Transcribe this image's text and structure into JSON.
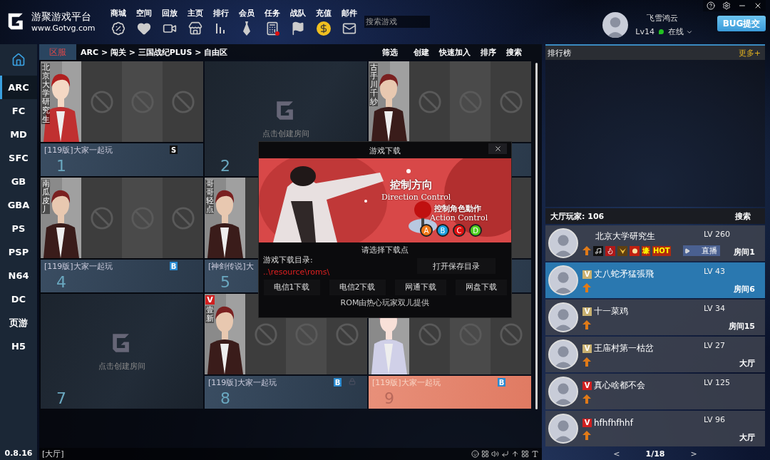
{
  "app": {
    "title": "游聚游戏平台",
    "url": "www.Gotvg.com"
  },
  "nav": [
    {
      "label": "商城",
      "kind": "sale"
    },
    {
      "label": "空间",
      "kind": "heart"
    },
    {
      "label": "回放",
      "kind": "video"
    },
    {
      "label": "主页",
      "kind": "store"
    },
    {
      "label": "排行",
      "kind": "bars"
    },
    {
      "label": "会员",
      "kind": "tie"
    },
    {
      "label": "任务",
      "kind": "calc",
      "alert": true
    },
    {
      "label": "战队",
      "kind": "flag"
    },
    {
      "label": "充值",
      "kind": "coin"
    },
    {
      "label": "邮件",
      "kind": "mail"
    }
  ],
  "search": {
    "placeholder": "搜索游戏"
  },
  "user": {
    "name": "飞雪鸿云",
    "level": "Lv14",
    "status": "在线"
  },
  "bug_button": "BUG提交",
  "sidebar": {
    "items": [
      {
        "label": "ARC",
        "selected": true
      },
      {
        "label": "FC",
        "selected": false
      },
      {
        "label": "MD",
        "selected": false
      },
      {
        "label": "SFC",
        "selected": false
      },
      {
        "label": "GB",
        "selected": false
      },
      {
        "label": "GBA",
        "selected": false
      },
      {
        "label": "PS",
        "selected": false
      },
      {
        "label": "PSP",
        "selected": false
      },
      {
        "label": "N64",
        "selected": false
      },
      {
        "label": "DC",
        "selected": false
      },
      {
        "label": "页游",
        "selected": false
      },
      {
        "label": "H5",
        "selected": false
      }
    ],
    "version": "0.8.16"
  },
  "breadcrumb": {
    "tab": "区服",
    "path": "ARC > 闯关 > 三国战纪PLUS > 自由区",
    "actions": [
      "筛选",
      "创建",
      "快速加入",
      "排序",
      "搜索"
    ]
  },
  "rooms": [
    {
      "kind": "occupied",
      "portrait": true,
      "player": "北京大学研究生",
      "title": "[119版]大家一起玩",
      "badge": "S",
      "number": "1",
      "locked": false,
      "selected": false
    },
    {
      "kind": "empty",
      "prompt": "点击创建房间",
      "number": "2"
    },
    {
      "kind": "occupied",
      "portrait": true,
      "player": "古手川千紗",
      "locked": false,
      "selected": false
    },
    {
      "kind": "occupied",
      "portrait": true,
      "player": "南瓜皮丿",
      "title": "[119版]大家一起玩",
      "badge": "B",
      "number": "4",
      "locked": false,
      "selected": false
    },
    {
      "kind": "occupied_covered",
      "portrait": true,
      "player": "哥哥轻点",
      "title": "[神剑传说]大",
      "number": "5",
      "locked": false,
      "selected": false
    },
    {
      "kind": "covered"
    },
    {
      "kind": "empty",
      "prompt": "点击创建房间",
      "number": "7"
    },
    {
      "kind": "occupied",
      "portrait": true,
      "vip": "V",
      "player": "壹新",
      "title": "[119版]大家一起玩",
      "badge": "B",
      "locked": true,
      "number": "8",
      "selected": false
    },
    {
      "kind": "occupied",
      "portrait": true,
      "title": "[119版]大家一起玩",
      "badge": "B",
      "number": "9",
      "locked": false,
      "selected": true
    }
  ],
  "status_bar": {
    "location": "[大厅]"
  },
  "ranking": {
    "title": "排行榜",
    "more": "更多+"
  },
  "lobby": {
    "title": "大厅玩家: 106",
    "search": "搜索",
    "page": "1/18",
    "prev": "<",
    "next": ">",
    "players": [
      {
        "name": "北京大学研究生",
        "level": "LV 260",
        "location": "房间1",
        "selected": false,
        "badges": [
          {
            "kind": "note"
          },
          {
            "kind": "fist"
          },
          {
            "kind": "wings"
          },
          {
            "kind": "bomb"
          },
          {
            "kind": "text",
            "text": "壕"
          },
          {
            "kind": "text",
            "text": "HOT"
          }
        ],
        "live": "直播"
      },
      {
        "name": "丈八蛇矛猛張飛",
        "level": "LV 43",
        "location": "房间6",
        "selected": true,
        "vip": {
          "text": "V",
          "kind": "gold"
        }
      },
      {
        "name": "十一菜鸡",
        "level": "LV 34",
        "location": "房间15",
        "selected": false,
        "vip": {
          "text": "V",
          "kind": "gold"
        }
      },
      {
        "name": "王庙村第一枯岔",
        "level": "LV 27",
        "location": "大厅",
        "selected": false,
        "vip": {
          "text": "V",
          "kind": "gold"
        }
      },
      {
        "name": "真心啥都不会",
        "level": "LV 125",
        "selected": false,
        "vip": {
          "text": "V",
          "kind": "red"
        }
      },
      {
        "name": "hfhfhfhhf",
        "level": "LV 96",
        "location": "大厅",
        "selected": false,
        "vip": {
          "text": "V",
          "kind": "red"
        }
      }
    ]
  },
  "dialog": {
    "title": "游戏下载",
    "banner": {
      "direction": "控制方向",
      "direction_en": "Direction Control",
      "action": "控制角色動作",
      "action_en": "Action Control",
      "buttons": [
        {
          "label": "A",
          "color": "#f07818"
        },
        {
          "label": "B",
          "color": "#1aa0e0"
        },
        {
          "label": "C",
          "color": "#e01010"
        },
        {
          "label": "D",
          "color": "#50d020"
        }
      ]
    },
    "prompt": "请选择下载点",
    "dir_label": "游戏下载目录:",
    "dir_path": "..\\resource\\roms\\",
    "open_button": "打开保存目录",
    "download_buttons": [
      "电信1下载",
      "电信2下载",
      "网通下载",
      "网盘下载"
    ],
    "footer": "ROM由热心玩家双儿提供"
  }
}
